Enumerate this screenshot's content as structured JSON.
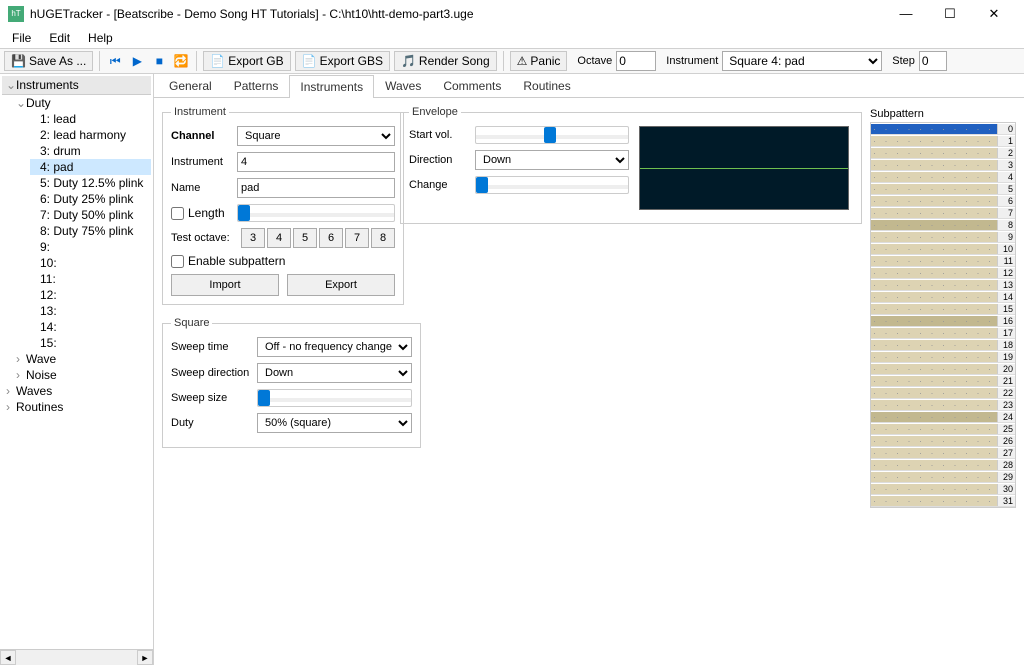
{
  "title": "hUGETracker - [Beatscribe - Demo Song HT Tutorials] - C:\\ht10\\htt-demo-part3.uge",
  "menu": {
    "file": "File",
    "edit": "Edit",
    "help": "Help"
  },
  "toolbar": {
    "saveas": "Save As ...",
    "exportgb": "Export GB",
    "exportgbs": "Export GBS",
    "render": "Render Song",
    "panic": "Panic",
    "octave_lbl": "Octave",
    "octave_val": "0",
    "instrument_lbl": "Instrument",
    "instrument_val": "Square 4: pad",
    "step_lbl": "Step",
    "step_val": "0"
  },
  "tree": {
    "header": "Instruments",
    "duty": "Duty",
    "items": [
      "1: lead",
      "2: lead harmony",
      "3: drum",
      "4: pad",
      "5: Duty 12.5% plink",
      "6: Duty 25% plink",
      "7: Duty 50% plink",
      "8: Duty 75% plink",
      "9:",
      "10:",
      "11:",
      "12:",
      "13:",
      "14:",
      "15:"
    ],
    "wave": "Wave",
    "noise": "Noise",
    "waves": "Waves",
    "routines": "Routines"
  },
  "tabs": [
    "General",
    "Patterns",
    "Instruments",
    "Waves",
    "Comments",
    "Routines"
  ],
  "instrument_panel": {
    "legend": "Instrument",
    "channel_lbl": "Channel",
    "channel_val": "Square",
    "instr_lbl": "Instrument",
    "instr_val": "4",
    "name_lbl": "Name",
    "name_val": "pad",
    "length_lbl": "Length",
    "testoct_lbl": "Test octave:",
    "oct_btns": [
      "3",
      "4",
      "5",
      "6",
      "7",
      "8"
    ],
    "enable_sub": "Enable subpattern",
    "import": "Import",
    "export": "Export"
  },
  "square_panel": {
    "legend": "Square",
    "sweep_time_lbl": "Sweep time",
    "sweep_time_val": "Off - no frequency change",
    "sweep_dir_lbl": "Sweep direction",
    "sweep_dir_val": "Down",
    "sweep_size_lbl": "Sweep size",
    "duty_lbl": "Duty",
    "duty_val": "50% (square)"
  },
  "envelope_panel": {
    "legend": "Envelope",
    "startvol_lbl": "Start vol.",
    "direction_lbl": "Direction",
    "direction_val": "Down",
    "change_lbl": "Change"
  },
  "subpattern": {
    "header": "Subpattern"
  }
}
